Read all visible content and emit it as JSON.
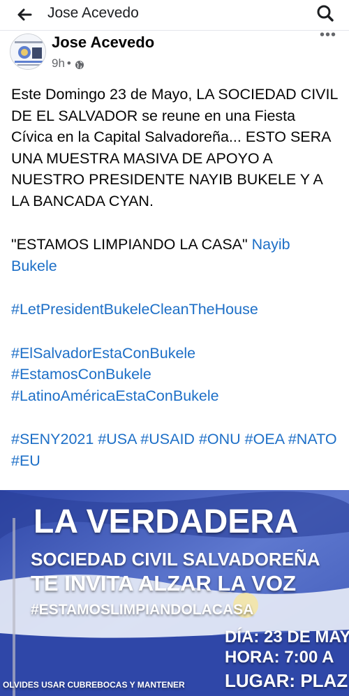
{
  "topbar": {
    "title": "Jose Acevedo"
  },
  "post": {
    "author": "Jose Acevedo",
    "time": "9h",
    "separator": "•",
    "paragraph1": "Este Domingo 23 de Mayo, LA SOCIEDAD CIVIL DE EL SALVADOR se reune en una Fiesta Cívica en la Capital Salvadoreña... ESTO SERA UNA MUESTRA MASIVA DE APOYO A NUESTRO PRESIDENTE NAYIB BUKELE Y A LA BANCADA CYAN.",
    "quote": "\"ESTAMOS LIMPIANDO LA CASA\" ",
    "mention": "Nayib Bukele",
    "hashtag1": "#LetPresidentBukeleCleanTheHouse",
    "hashtag2": "#ElSalvadorEstaConBukele",
    "hashtag3": "#EstamosConBukele",
    "hashtag4": "#LatinoAméricaEstaConBukele",
    "hashtag_row": [
      "#SENY2021",
      "#USA",
      "#USAID",
      "#ONU",
      "#OEA",
      "#NATO",
      "#EU"
    ]
  },
  "banner": {
    "line1": "LA VERDADERA",
    "line2": "SOCIEDAD CIVIL SALVADOREÑA",
    "line3": "TE INVITA ALZAR LA VOZ",
    "line4": "#ESTAMOSLIMPIANDOLACASA",
    "line5": "DÍA: 23 DE MAY",
    "line6": "HORA: 7:00 A",
    "line7": "LUGAR: PLAZ",
    "line8": "OLVIDES USAR CUBREBOCAS Y MANTENER"
  },
  "colors": {
    "link": "#1d6fc7",
    "banner_blue": "#3f57b5",
    "meta_gray": "#65676b"
  },
  "icons": [
    "back-arrow-icon",
    "search-icon",
    "globe-icon",
    "more-options-icon"
  ]
}
